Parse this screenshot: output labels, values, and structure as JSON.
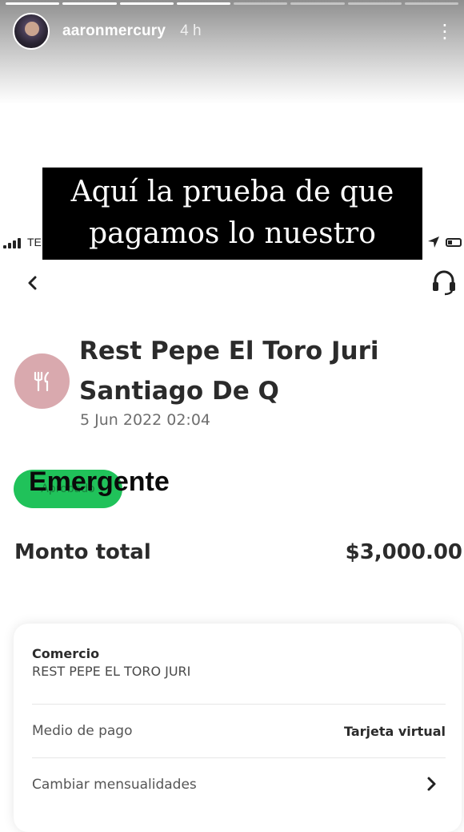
{
  "story": {
    "username": "aaronmercury",
    "time_ago": "4 h",
    "progress_total": 8,
    "progress_done": 4,
    "caption_line1": "Aquí la prueba de que",
    "caption_line2": "pagamos lo nuestro",
    "sticker": "Emergente"
  },
  "statusbar": {
    "carrier": "TE"
  },
  "transaction": {
    "merchant_line1": "Rest Pepe El Toro Juri",
    "merchant_line2": "Santiago De Q",
    "date": "5 Jun 2022 02:04",
    "status_badge": "Aprobado",
    "total_label": "Monto total",
    "total_value": "$3,000.00"
  },
  "details": {
    "comercio_label": "Comercio",
    "comercio_value": "REST PEPE EL TORO JURI",
    "medio_label": "Medio de pago",
    "medio_value": "Tarjeta virtual",
    "mensualidades_label": "Cambiar mensualidades"
  },
  "colors": {
    "badge_green": "#20c25a",
    "merchant_icon_bg": "#d9a9ae",
    "caption_bg": "#000000"
  },
  "icons": [
    "more-vertical-icon",
    "signal-icon",
    "location-arrow-icon",
    "battery-icon",
    "back-chevron-icon",
    "headset-icon",
    "fork-knife-icon",
    "chevron-right-icon"
  ]
}
